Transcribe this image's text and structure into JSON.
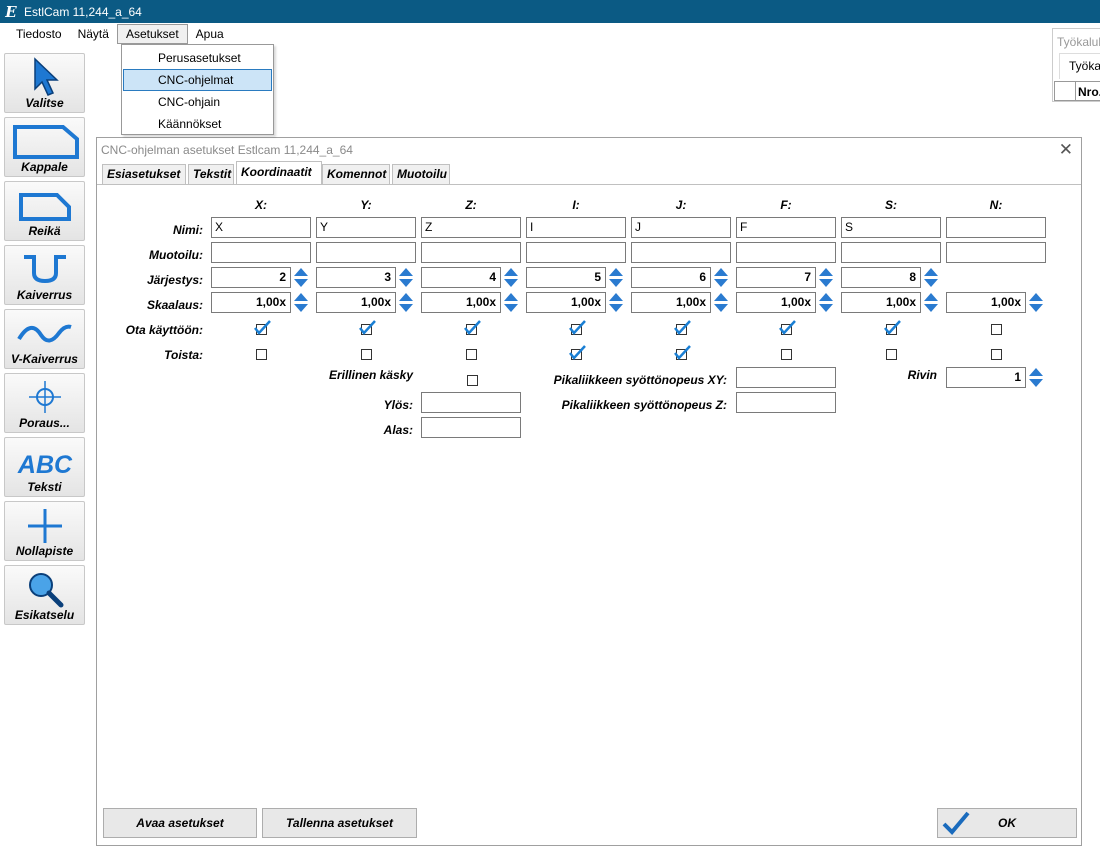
{
  "window": {
    "title": "EstlCam 11,244_a_64",
    "icon_letter": "E"
  },
  "menu": {
    "items": [
      "Tiedosto",
      "Näytä",
      "Asetukset",
      "Apua"
    ],
    "dropdown": [
      "Perusasetukset",
      "CNC-ohjelmat",
      "CNC-ohjain",
      "Käännökset"
    ]
  },
  "toolbar": {
    "tools": [
      "Valitse",
      "Kappale",
      "Reikä",
      "Kaiverrus",
      "V-Kaiverrus",
      "Poraus...",
      "Teksti",
      "Nollapiste",
      "Esikatselu"
    ]
  },
  "tool_panel": {
    "title": "Työkalul",
    "tab": "Työkal",
    "column": "Nro."
  },
  "dialog": {
    "title": "CNC-ohjelman asetukset Estlcam 11,244_a_64",
    "close_glyph": "✕",
    "tabs": [
      "Esiasetukset",
      "Tekstit",
      "Koordinaatit",
      "Komennot",
      "Muotoilu"
    ],
    "active_tab": "Koordinaatit",
    "columns": [
      "X:",
      "Y:",
      "Z:",
      "I:",
      "J:",
      "F:",
      "S:",
      "N:"
    ],
    "row_labels": {
      "nimi": "Nimi:",
      "muotoilu": "Muotoilu:",
      "jarjestys": "Järjestys:",
      "skaalaus": "Skaalaus:",
      "ota_kayttoon": "Ota käyttöön:",
      "toista": "Toista:"
    },
    "nimi_values": [
      "X",
      "Y",
      "Z",
      "I",
      "J",
      "F",
      "S",
      ""
    ],
    "muotoilu_values": [
      "",
      "",
      "",
      "",
      "",
      "",
      "",
      ""
    ],
    "jarjestys_values": [
      "2",
      "3",
      "4",
      "5",
      "6",
      "7",
      "8"
    ],
    "skaalaus_values": [
      "1,00x",
      "1,00x",
      "1,00x",
      "1,00x",
      "1,00x",
      "1,00x",
      "1,00x",
      "1,00x"
    ],
    "ota_kayttoon_checked": [
      true,
      true,
      true,
      true,
      true,
      true,
      true,
      false
    ],
    "toista_checked": [
      false,
      false,
      false,
      true,
      true,
      false,
      false,
      false
    ],
    "extra": {
      "erillinen_label": "Erillinen käsky",
      "erillinen_checked": false,
      "ylos_label": "Ylös:",
      "ylos_value": "",
      "alas_label": "Alas:",
      "alas_value": "",
      "xy_label": "Pikaliikkeen syöttönopeus XY:",
      "xy_value": "",
      "z_label": "Pikaliikkeen syöttönopeus Z:",
      "z_value": "",
      "rivin_label": "Rivin",
      "rivin_value": "1"
    },
    "buttons": {
      "open": "Avaa asetukset",
      "save": "Tallenna asetukset",
      "ok": "OK"
    }
  },
  "colors": {
    "titlebar": "#0b5a84",
    "tool_blue": "#1e78d2",
    "selection": "#cce4f7",
    "check_blue": "#1a7fd4"
  }
}
